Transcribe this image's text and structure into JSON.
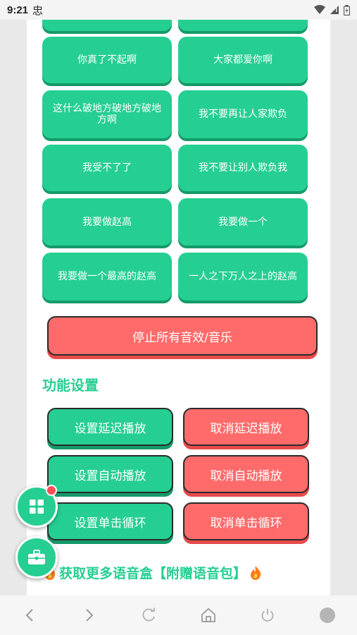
{
  "status_bar": {
    "time": "9:21",
    "notif_icon": "忠"
  },
  "sound_buttons": [
    {
      "label": ""
    },
    {
      "label": ""
    },
    {
      "label": "你真了不起啊"
    },
    {
      "label": "大家都爱你啊"
    },
    {
      "label": "这什么破地方破地方破地方啊"
    },
    {
      "label": "我不要再让人家欺负"
    },
    {
      "label": "我受不了了"
    },
    {
      "label": "我不要让别人欺负我"
    },
    {
      "label": "我要做赵高"
    },
    {
      "label": "我要做一个"
    },
    {
      "label": "我要做一个最高的赵高"
    },
    {
      "label": "一人之下万人之上的赵高"
    }
  ],
  "stop_button": {
    "label": "停止所有音效/音乐"
  },
  "settings": {
    "title": "功能设置",
    "buttons": [
      {
        "label": "设置延迟播放",
        "variant": "green"
      },
      {
        "label": "取消延迟播放",
        "variant": "red"
      },
      {
        "label": "设置自动播放",
        "variant": "green"
      },
      {
        "label": "取消自动播放",
        "variant": "red"
      },
      {
        "label": "设置单击循环",
        "variant": "green"
      },
      {
        "label": "取消单击循环",
        "variant": "red"
      }
    ]
  },
  "promo": {
    "text": "获取更多语音盒【附赠语音包】"
  },
  "colors": {
    "accent_green": "#25cf91",
    "accent_red": "#ff6b6b",
    "badge_red": "#ff4d57"
  },
  "icons": [
    "wifi-icon",
    "signal-icon",
    "battery-icon",
    "grid-icon",
    "toolbox-icon",
    "fire-icon",
    "back-icon",
    "forward-icon",
    "refresh-icon",
    "home-icon",
    "power-icon",
    "circle-icon"
  ]
}
